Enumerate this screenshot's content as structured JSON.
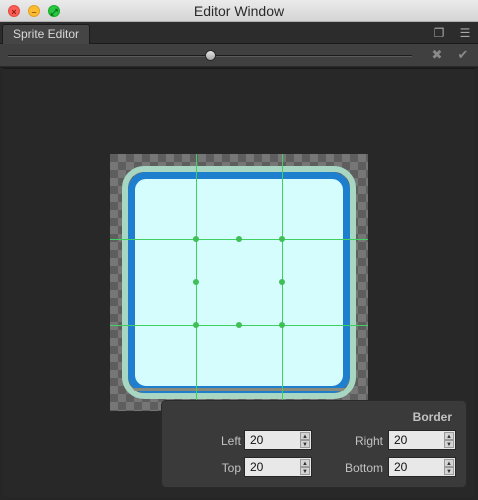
{
  "window": {
    "title": "Editor Window",
    "close_glyph": "×",
    "minimize_glyph": "–",
    "zoom_glyph": "⤢"
  },
  "tabs": [
    {
      "label": "Sprite Editor"
    }
  ],
  "tab_icons": {
    "maximize": "❐",
    "menu": "☰"
  },
  "toolbar": {
    "zoom_slider": {
      "value": 0.5
    },
    "revert_glyph": "✖",
    "apply_glyph": "✔"
  },
  "border_panel": {
    "title": "Border",
    "left": {
      "label": "Left",
      "value": "20"
    },
    "right": {
      "label": "Right",
      "value": "20"
    },
    "top": {
      "label": "Top",
      "value": "20"
    },
    "bottom": {
      "label": "Bottom",
      "value": "20"
    },
    "stepper_up": "▲",
    "stepper_down": "▼"
  },
  "colors": {
    "slice_guide": "#3fd060",
    "sprite_frame": "#1f7fcf",
    "sprite_fill": "#d6fdfd"
  },
  "icons": [
    "close-icon",
    "minimize-icon",
    "zoom-icon",
    "maximize-icon",
    "menu-icon",
    "revert-icon",
    "apply-icon"
  ]
}
